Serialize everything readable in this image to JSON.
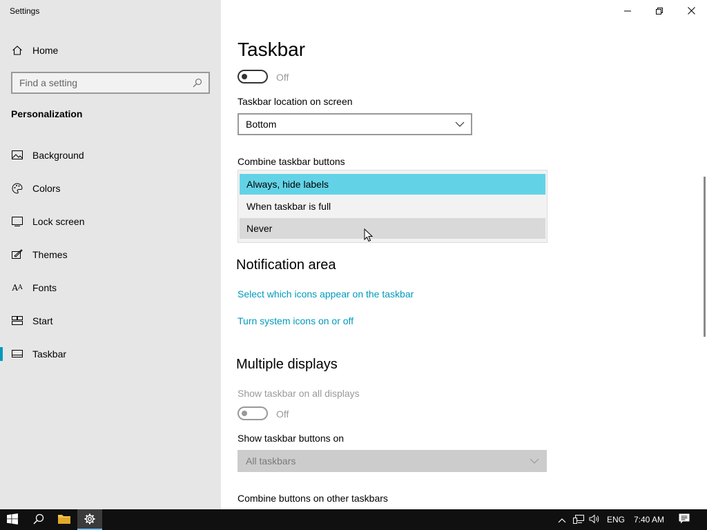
{
  "window": {
    "title": "Settings",
    "controls": [
      "minimize-icon",
      "restore-icon",
      "close-icon"
    ]
  },
  "sidebar": {
    "home_label": "Home",
    "search_placeholder": "Find a setting",
    "section": "Personalization",
    "items": [
      {
        "label": "Background",
        "icon": "background-icon"
      },
      {
        "label": "Colors",
        "icon": "colors-icon"
      },
      {
        "label": "Lock screen",
        "icon": "lock-screen-icon"
      },
      {
        "label": "Themes",
        "icon": "themes-icon"
      },
      {
        "label": "Fonts",
        "icon": "fonts-icon"
      },
      {
        "label": "Start",
        "icon": "start-icon"
      },
      {
        "label": "Taskbar",
        "icon": "taskbar-icon",
        "active": true
      }
    ]
  },
  "main": {
    "title": "Taskbar",
    "toggle1_state": "Off",
    "location_label": "Taskbar location on screen",
    "location_value": "Bottom",
    "combine_label": "Combine taskbar buttons",
    "combine_options": [
      "Always, hide labels",
      "When taskbar is full",
      "Never"
    ],
    "combine_selected": "Always, hide labels",
    "notification_heading": "Notification area",
    "link_icons": "Select which icons appear on the taskbar",
    "link_system_icons": "Turn system icons on or off",
    "multiple_heading": "Multiple displays",
    "show_all_label": "Show taskbar on all displays",
    "show_all_state": "Off",
    "buttons_on_label": "Show taskbar buttons on",
    "buttons_on_value": "All taskbars",
    "combine_other_label": "Combine buttons on other taskbars"
  },
  "taskbar": {
    "language": "ENG",
    "time": "7:40 AM"
  },
  "colors": {
    "accent": "#0099bc",
    "selected_option": "#62d3e6",
    "sidebar_bg": "#e6e6e6",
    "taskbar_bg": "#101010"
  }
}
